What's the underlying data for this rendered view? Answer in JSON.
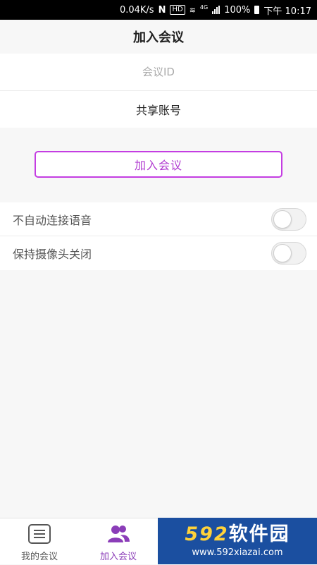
{
  "status_bar": {
    "speed": "0.04K/s",
    "hd": "HD",
    "network": "4G",
    "battery": "100%",
    "time": "下午 10:17"
  },
  "header": {
    "title": "加入会议"
  },
  "form": {
    "meeting_id_placeholder": "会议ID",
    "meeting_id_value": "",
    "share_account_label": "共享账号",
    "join_button_label": "加入会议",
    "accent_color": "#c43de2"
  },
  "settings": [
    {
      "label": "不自动连接语音",
      "enabled": false
    },
    {
      "label": "保持摄像头关闭",
      "enabled": false
    }
  ],
  "tabbar": {
    "items": [
      {
        "label": "我的会议",
        "icon": "list-icon",
        "active": false
      },
      {
        "label": "加入会议",
        "icon": "people-icon",
        "active": true
      }
    ],
    "active_color": "#8b3db8"
  },
  "watermark": {
    "logo_number": "592",
    "logo_text": "软件园",
    "url": "www.592xiazai.com"
  }
}
